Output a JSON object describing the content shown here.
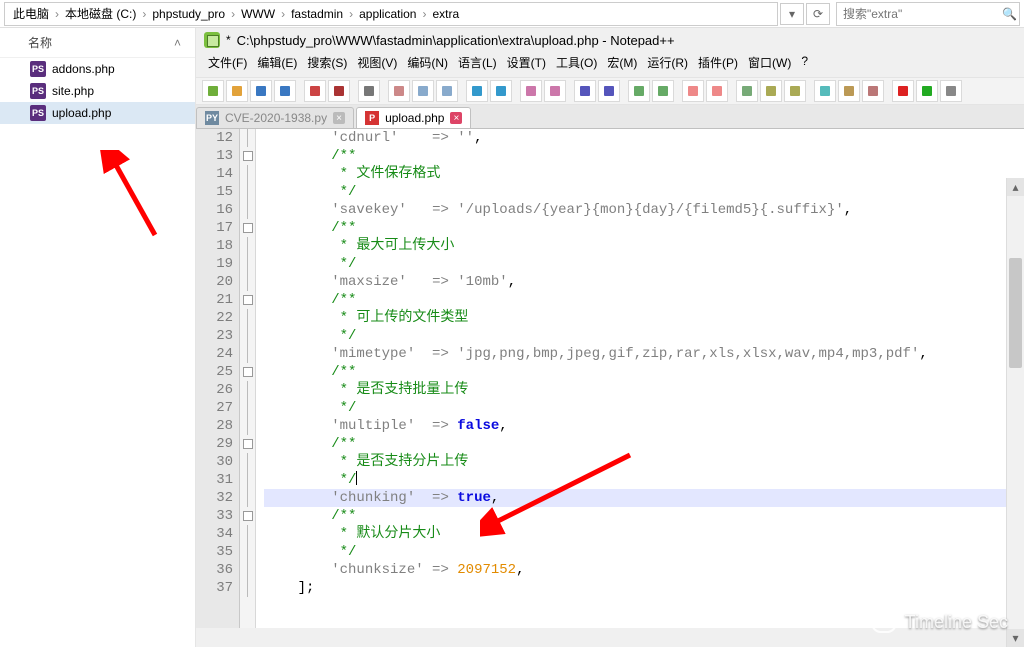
{
  "breadcrumb": [
    "此电脑",
    "本地磁盘 (C:)",
    "phpstudy_pro",
    "WWW",
    "fastadmin",
    "application",
    "extra"
  ],
  "addr_controls": {
    "dropdown": "▾",
    "refresh": "⟳"
  },
  "search": {
    "placeholder": "搜索\"extra\""
  },
  "explorer": {
    "column": "名称",
    "files": [
      {
        "name": "addons.php",
        "selected": false
      },
      {
        "name": "site.php",
        "selected": false
      },
      {
        "name": "upload.php",
        "selected": true
      }
    ]
  },
  "npp": {
    "modified": "*",
    "title": "C:\\phpstudy_pro\\WWW\\fastadmin\\application\\extra\\upload.php - Notepad++",
    "menu": [
      "文件(F)",
      "编辑(E)",
      "搜索(S)",
      "视图(V)",
      "编码(N)",
      "语言(L)",
      "设置(T)",
      "工具(O)",
      "宏(M)",
      "运行(R)",
      "插件(P)",
      "窗口(W)",
      "?"
    ],
    "toolbar_icons": [
      "new-file",
      "open-file",
      "save",
      "save-all",
      "sep",
      "close",
      "close-all",
      "sep",
      "print",
      "sep",
      "cut",
      "copy",
      "paste",
      "sep",
      "undo",
      "redo",
      "sep",
      "find",
      "replace",
      "sep",
      "zoom-in",
      "zoom-out",
      "sep",
      "sync",
      "wrap",
      "sep",
      "show-all",
      "indent-guide",
      "sep",
      "lang",
      "fold-all",
      "unfold-all",
      "sep",
      "doc-map",
      "func-list",
      "monitor",
      "sep",
      "record",
      "play",
      "stop"
    ],
    "tabs": [
      {
        "label": "CVE-2020-1938.py",
        "kind": "py",
        "active": false
      },
      {
        "label": "upload.php",
        "kind": "php",
        "active": true
      }
    ],
    "first_line_no": 12,
    "code": [
      {
        "n": 12,
        "raw": "        'cdnurl'    => '',",
        "fold": "line"
      },
      {
        "n": 13,
        "raw": "        /**",
        "fold": "box"
      },
      {
        "n": 14,
        "raw": "         * 文件保存格式",
        "fold": "line"
      },
      {
        "n": 15,
        "raw": "         */",
        "fold": "line"
      },
      {
        "n": 16,
        "raw": "        'savekey'   => '/uploads/{year}{mon}{day}/{filemd5}{.suffix}',",
        "fold": "line"
      },
      {
        "n": 17,
        "raw": "        /**",
        "fold": "box"
      },
      {
        "n": 18,
        "raw": "         * 最大可上传大小",
        "fold": "line"
      },
      {
        "n": 19,
        "raw": "         */",
        "fold": "line"
      },
      {
        "n": 20,
        "raw": "        'maxsize'   => '10mb',",
        "fold": "line"
      },
      {
        "n": 21,
        "raw": "        /**",
        "fold": "box"
      },
      {
        "n": 22,
        "raw": "         * 可上传的文件类型",
        "fold": "line"
      },
      {
        "n": 23,
        "raw": "         */",
        "fold": "line"
      },
      {
        "n": 24,
        "raw": "        'mimetype'  => 'jpg,png,bmp,jpeg,gif,zip,rar,xls,xlsx,wav,mp4,mp3,pdf',",
        "fold": "line"
      },
      {
        "n": 25,
        "raw": "        /**",
        "fold": "box"
      },
      {
        "n": 26,
        "raw": "         * 是否支持批量上传",
        "fold": "line"
      },
      {
        "n": 27,
        "raw": "         */",
        "fold": "line"
      },
      {
        "n": 28,
        "raw": "        'multiple'  => false,",
        "fold": "line"
      },
      {
        "n": 29,
        "raw": "        /**",
        "fold": "box"
      },
      {
        "n": 30,
        "raw": "         * 是否支持分片上传",
        "fold": "line"
      },
      {
        "n": 31,
        "raw": "         */",
        "fold": "line",
        "caret": true
      },
      {
        "n": 32,
        "raw": "        'chunking'  => true,",
        "fold": "line",
        "hl": true
      },
      {
        "n": 33,
        "raw": "        /**",
        "fold": "box"
      },
      {
        "n": 34,
        "raw": "         * 默认分片大小",
        "fold": "line"
      },
      {
        "n": 35,
        "raw": "         */",
        "fold": "line"
      },
      {
        "n": 36,
        "raw": "        'chunksize' => 2097152,",
        "fold": "line"
      },
      {
        "n": 37,
        "raw": "    ];",
        "fold": "line"
      }
    ]
  },
  "watermark": "Timeline Sec"
}
